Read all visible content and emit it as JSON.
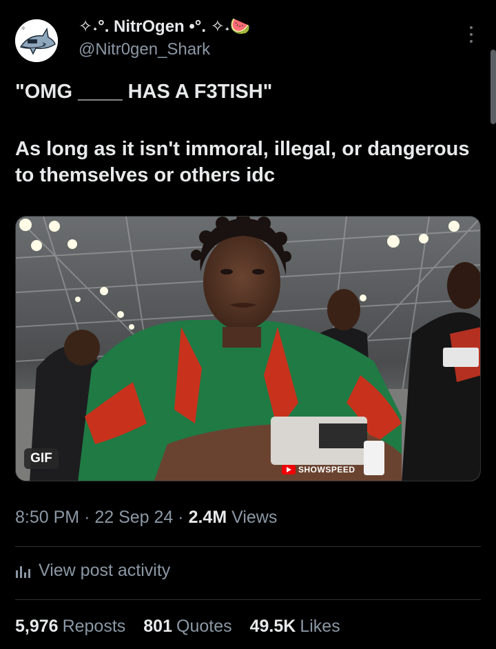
{
  "author": {
    "display_name": "✧˖°. NitrOgen •°. ✧˖",
    "name_emoji": "🍉",
    "handle": "@Nitr0gen_Shark",
    "avatar_icon": "shark-icon"
  },
  "tweet": {
    "line1": "\"OMG ____ HAS A F3TISH\"",
    "line2": "As long as it isn't immoral, illegal, or dangerous to themselves or others idc"
  },
  "media": {
    "badge": "GIF",
    "watermark": "SHOWSPEED"
  },
  "meta": {
    "time": "8:50 PM",
    "sep1": "·",
    "date": "22 Sep 24",
    "sep2": "·",
    "views_count": "2.4M",
    "views_label": "Views"
  },
  "activity": {
    "label": "View post activity",
    "icon": "analytics-icon"
  },
  "stats": {
    "reposts_count": "5,976",
    "reposts_label": "Reposts",
    "quotes_count": "801",
    "quotes_label": "Quotes",
    "likes_count": "49.5K",
    "likes_label": "Likes"
  },
  "colors": {
    "background": "#000000",
    "primary_text": "#e7e9ea",
    "secondary_text": "#8b98a5",
    "jersey_green": "#1f7a44",
    "jersey_red": "#c8321c"
  }
}
